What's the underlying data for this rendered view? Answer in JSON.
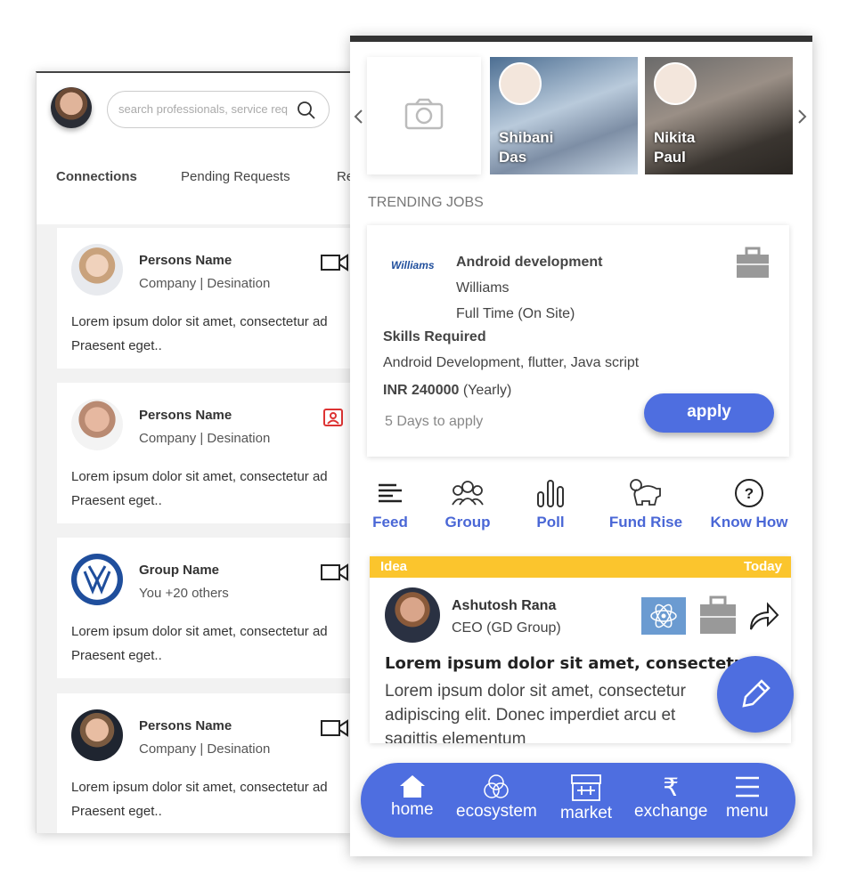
{
  "left_screen": {
    "search": {
      "placeholder": "search professionals, service req"
    },
    "tabs": [
      {
        "label": "Connections"
      },
      {
        "label": "Pending Requests"
      },
      {
        "label": "Re"
      }
    ],
    "cards": [
      {
        "name": "Persons Name",
        "subtitle": "Company | Desination",
        "text1": "Lorem ipsum dolor sit amet, consectetur ad",
        "text2": "Praesent eget..",
        "icon": "video-camera-icon"
      },
      {
        "name": "Persons Name",
        "subtitle": "Company | Desination",
        "text1": "Lorem ipsum dolor sit amet, consectetur ad",
        "text2": "Praesent eget..",
        "icon": "contact-card-icon"
      },
      {
        "name": "Group Name",
        "subtitle": "You +20 others",
        "text1": "Lorem ipsum dolor sit amet, consectetur ad",
        "text2": "Praesent eget..",
        "icon": "video-camera-icon"
      },
      {
        "name": "Persons Name",
        "subtitle": "Company | Desination",
        "text1": "Lorem ipsum dolor sit amet, consectetur ad",
        "text2": "Praesent eget..",
        "icon": "video-camera-icon"
      }
    ]
  },
  "right_screen": {
    "stories": [
      {
        "name1": "Shibani",
        "name2": "Das"
      },
      {
        "name1": "Nikita",
        "name2": "Paul"
      }
    ],
    "trending_label": "TRENDING JOBS",
    "job": {
      "company_logo": "Williams",
      "title": "Android development",
      "company": "Williams",
      "type": "Full Time (On Site)",
      "skills_label": "Skills Required",
      "skills": "Android Development, flutter, Java script",
      "salary": "INR 240000",
      "salary_period": "(Yearly)",
      "deadline": "5 Days to apply",
      "apply_label": "apply"
    },
    "features": [
      {
        "label": "Feed"
      },
      {
        "label": "Group"
      },
      {
        "label": "Poll"
      },
      {
        "label": "Fund Rise"
      },
      {
        "label": "Know How"
      }
    ],
    "post": {
      "category": "Idea",
      "date": "Today",
      "author": "Ashutosh Rana",
      "role": "CEO (GD Group)",
      "title": "Lorem ipsum dolor sit amet, consectetur",
      "body1": "Lorem ipsum dolor sit amet, consectetur",
      "body2": "adipiscing elit. Donec imperdiet arcu et",
      "body3": "sagittis elementum"
    },
    "nav": [
      {
        "label": "home"
      },
      {
        "label": "ecosystem"
      },
      {
        "label": "market"
      },
      {
        "label": "exchange"
      },
      {
        "label": "menu"
      }
    ],
    "colors": {
      "accent": "#4e6ee0",
      "idea_banner": "#fbc52d"
    }
  }
}
